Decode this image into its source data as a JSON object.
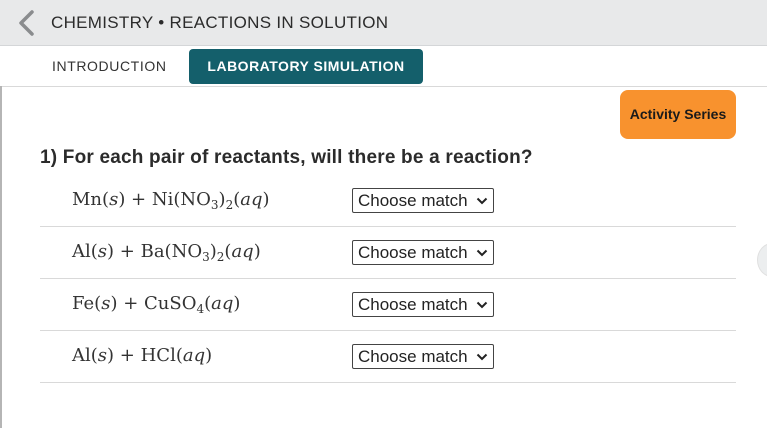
{
  "header": {
    "title": "CHEMISTRY • REACTIONS IN SOLUTION"
  },
  "tabs": [
    {
      "label": "INTRODUCTION",
      "active": false
    },
    {
      "label": "LABORATORY SIMULATION",
      "active": true
    }
  ],
  "activity_button": {
    "label": "Activity Series"
  },
  "question": {
    "text": "1) For each pair of reactants, will there be a reaction?"
  },
  "reactions": [
    {
      "metal": "Mn",
      "metal_state": "s",
      "reagent": "Ni(NO3)2",
      "reagent_state": "aq",
      "select_value": "Choose match"
    },
    {
      "metal": "Al",
      "metal_state": "s",
      "reagent": "Ba(NO3)2",
      "reagent_state": "aq",
      "select_value": "Choose match"
    },
    {
      "metal": "Fe",
      "metal_state": "s",
      "reagent": "CuSO4",
      "reagent_state": "aq",
      "select_value": "Choose match"
    },
    {
      "metal": "Al",
      "metal_state": "s",
      "reagent": "HCl",
      "reagent_state": "aq",
      "select_value": "Choose match"
    }
  ],
  "colors": {
    "topbar_bg": "#e8e9ea",
    "active_tab_bg": "#145f6b",
    "activity_button_bg": "#f8922e"
  },
  "icons": {
    "back": "chevron-left-icon",
    "select": "chevron-down-icon"
  }
}
